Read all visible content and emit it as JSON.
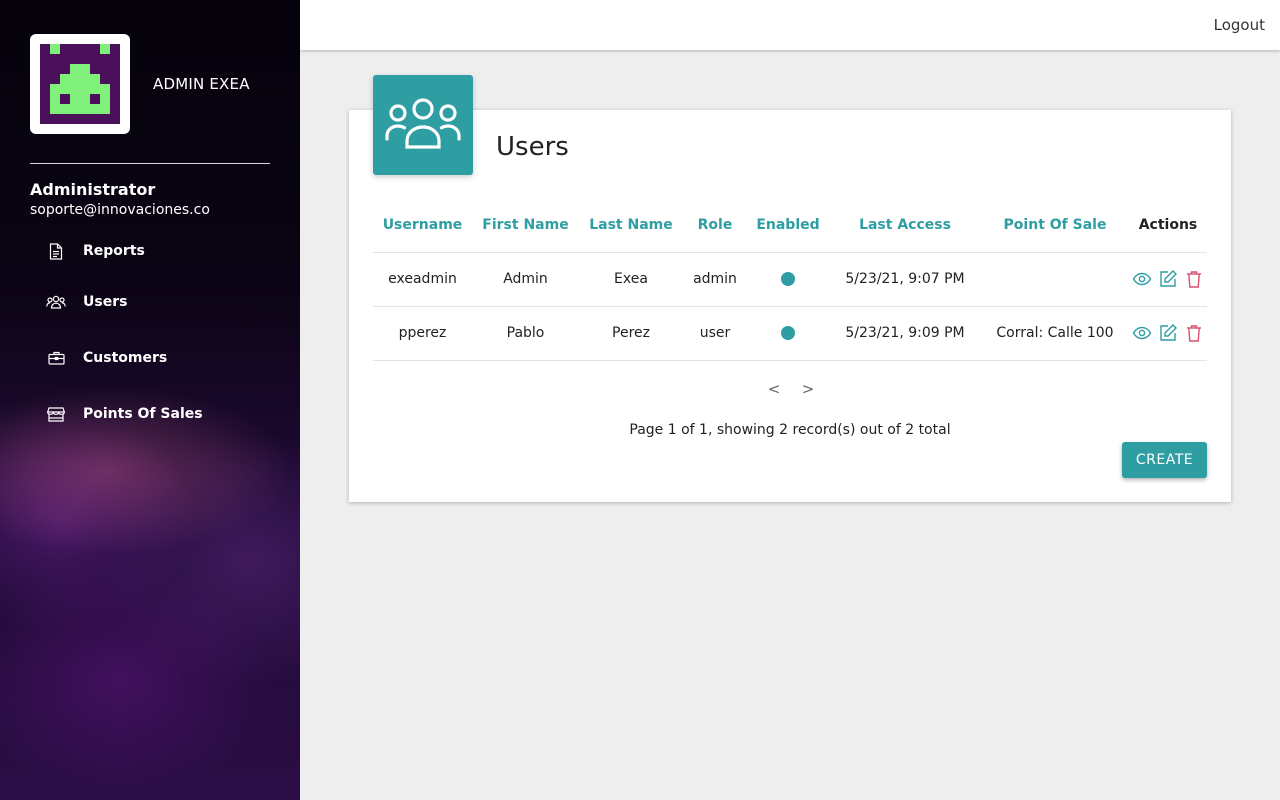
{
  "sidebar": {
    "brand": "ADMIN EXEA",
    "user": {
      "name": "Administrator",
      "email": "soporte@innovaciones.co"
    },
    "items": [
      {
        "label": "Reports",
        "icon": "document-icon"
      },
      {
        "label": "Users",
        "icon": "users-icon"
      },
      {
        "label": "Customers",
        "icon": "briefcase-icon"
      },
      {
        "label": "Points Of Sales",
        "icon": "store-icon"
      }
    ]
  },
  "topbar": {
    "logout": "Logout"
  },
  "main": {
    "title": "Users",
    "columns": [
      "Username",
      "First Name",
      "Last Name",
      "Role",
      "Enabled",
      "Last Access",
      "Point Of Sale",
      "Actions"
    ],
    "rows": [
      {
        "username": "exeadmin",
        "first_name": "Admin",
        "last_name": "Exea",
        "role": "admin",
        "enabled": true,
        "last_access": "5/23/21, 9:07 PM",
        "point_of_sale": ""
      },
      {
        "username": "pperez",
        "first_name": "Pablo",
        "last_name": "Perez",
        "role": "user",
        "enabled": true,
        "last_access": "5/23/21, 9:09 PM",
        "point_of_sale": "Corral: Calle 100"
      }
    ],
    "pager": {
      "prev": "<",
      "next": ">"
    },
    "page_info": "Page 1 of 1, showing 2 record(s) out of 2 total",
    "create_label": "CREATE"
  },
  "colors": {
    "accent": "#2e9ea3",
    "danger": "#d9506f",
    "logo_purple": "#4a1059",
    "logo_green": "#7ff07a"
  }
}
